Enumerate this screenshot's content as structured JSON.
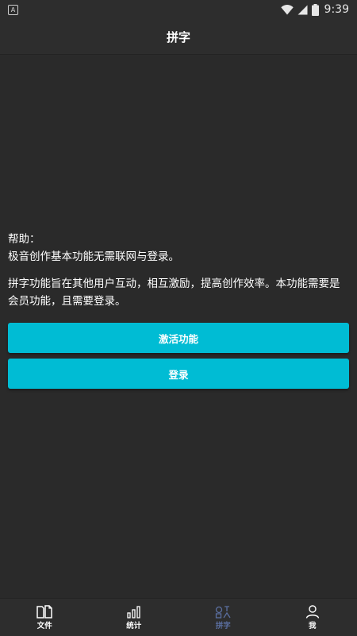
{
  "status_bar": {
    "app_badge": "A",
    "time": "9:39",
    "icons": [
      "wifi-icon",
      "signal-icon",
      "battery-icon"
    ]
  },
  "header": {
    "title": "拼字"
  },
  "main": {
    "help_line1": "帮助：",
    "help_line2": "极音创作基本功能无需联网与登录。",
    "description": "拼字功能旨在其他用户互动，相互激励，提高创作效率。本功能需要是会员功能，且需要登录。",
    "activate_button": "激活功能",
    "login_button": "登录"
  },
  "bottom_nav": {
    "items": [
      {
        "label": "文件",
        "icon": "file-icon"
      },
      {
        "label": "统计",
        "icon": "bar-chart-icon"
      },
      {
        "label": "拼字",
        "icon": "spell-icon",
        "active": true
      },
      {
        "label": "我",
        "icon": "user-icon"
      }
    ]
  },
  "colors": {
    "background": "#2a2a2a",
    "bar": "#2d2d2d",
    "accent_button": "#00bcd4",
    "active_tab": "#5b6fa0"
  }
}
